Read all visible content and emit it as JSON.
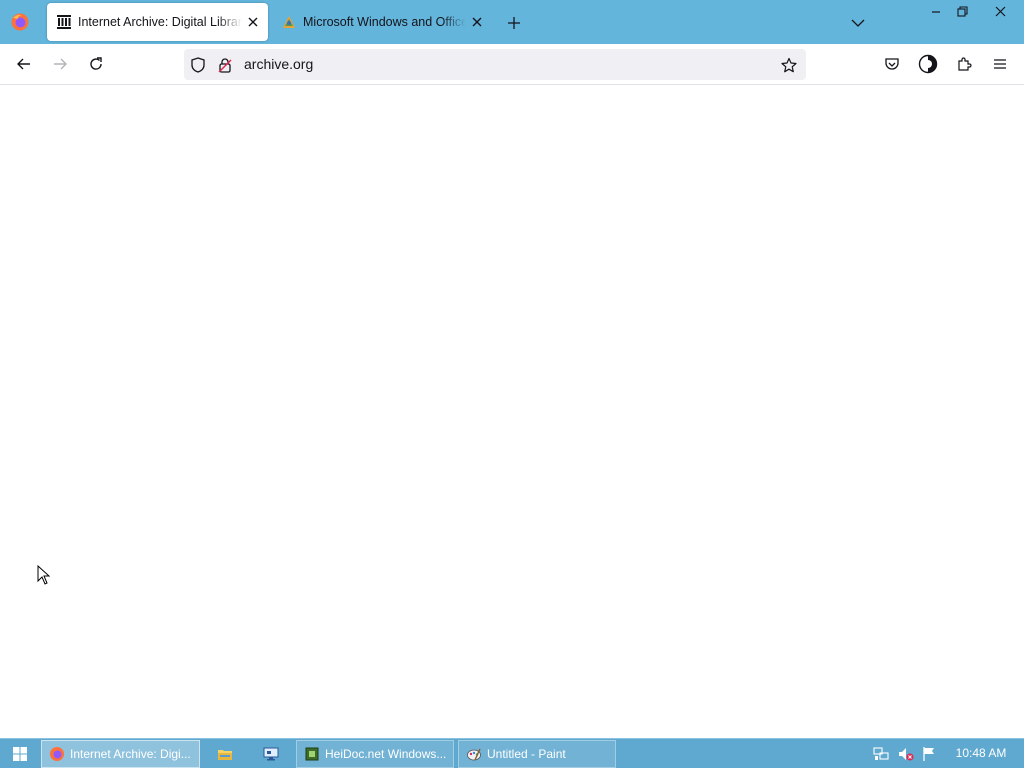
{
  "browser": {
    "tabs": [
      {
        "label": "Internet Archive: Digital Library",
        "active": true,
        "favicon": "archive-icon"
      },
      {
        "label": "Microsoft Windows and Office ISO",
        "active": false,
        "favicon": "heidoc-icon"
      }
    ],
    "url": "archive.org"
  },
  "taskbar": {
    "items": [
      {
        "label": "Internet Archive: Digi...",
        "icon": "firefox-icon",
        "active": true
      },
      {
        "label": "",
        "icon": "file-explorer-icon"
      },
      {
        "label": "",
        "icon": "network-connections-icon"
      },
      {
        "label": "HeiDoc.net Windows...",
        "icon": "heidoc-app-icon"
      },
      {
        "label": "Untitled - Paint",
        "icon": "paint-icon"
      }
    ],
    "clock": "10:48 AM"
  },
  "colors": {
    "titlebar": "#63b5dc",
    "taskbar": "#5fa8cf"
  }
}
